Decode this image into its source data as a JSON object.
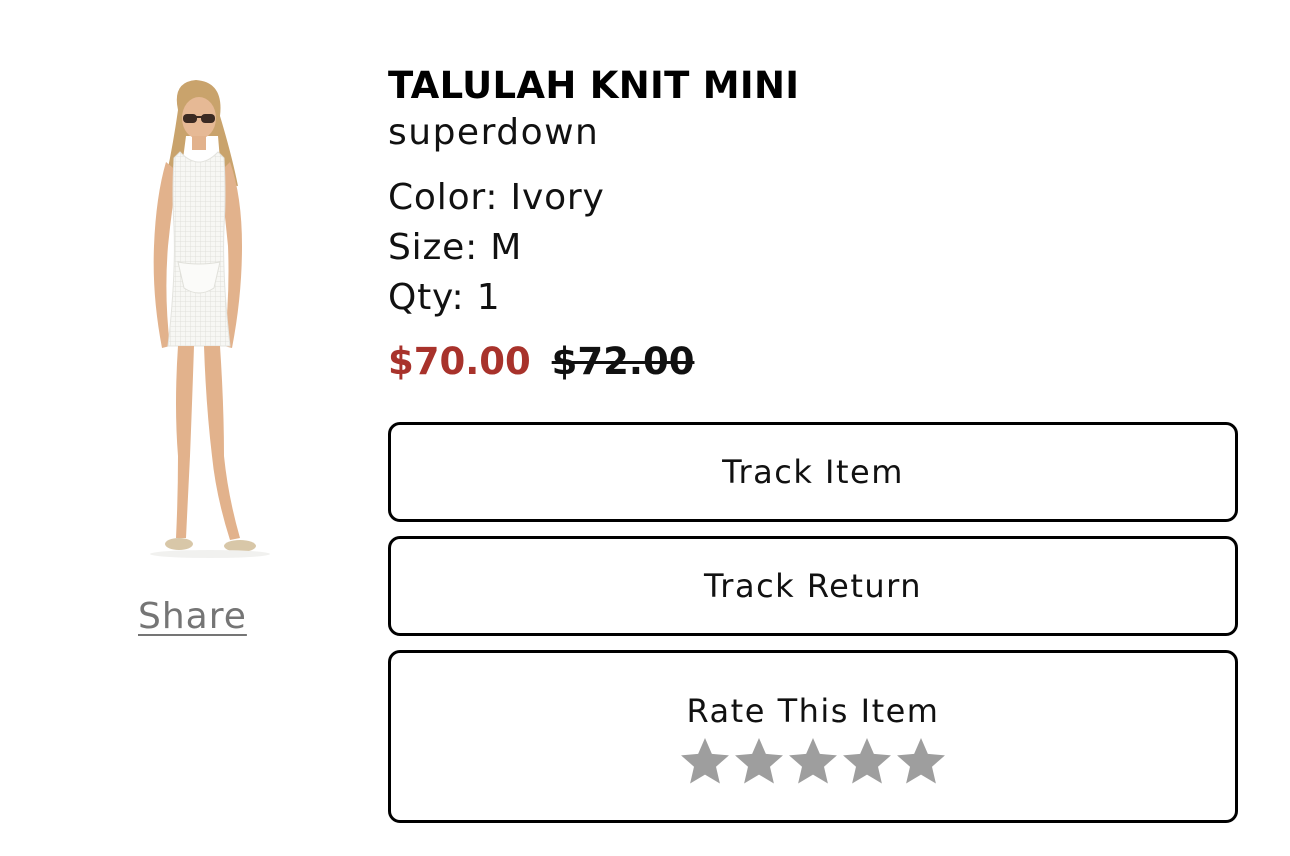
{
  "product": {
    "title": "TALULAH KNIT MINI",
    "brand": "superdown",
    "color_label": "Color:",
    "color_value": "Ivory",
    "size_label": "Size:",
    "size_value": "M",
    "qty_label": "Qty:",
    "qty_value": "1",
    "sale_price": "$70.00",
    "original_price": "$72.00"
  },
  "actions": {
    "share_label": "Share",
    "track_item_label": "Track Item",
    "track_return_label": "Track Return",
    "rate_label": "Rate This Item"
  },
  "rating": {
    "max_stars": 5,
    "current": 0,
    "star_color": "#9e9e9e"
  },
  "colors": {
    "sale_price": "#a8322b",
    "share_link": "#757575",
    "button_border": "#000000"
  }
}
